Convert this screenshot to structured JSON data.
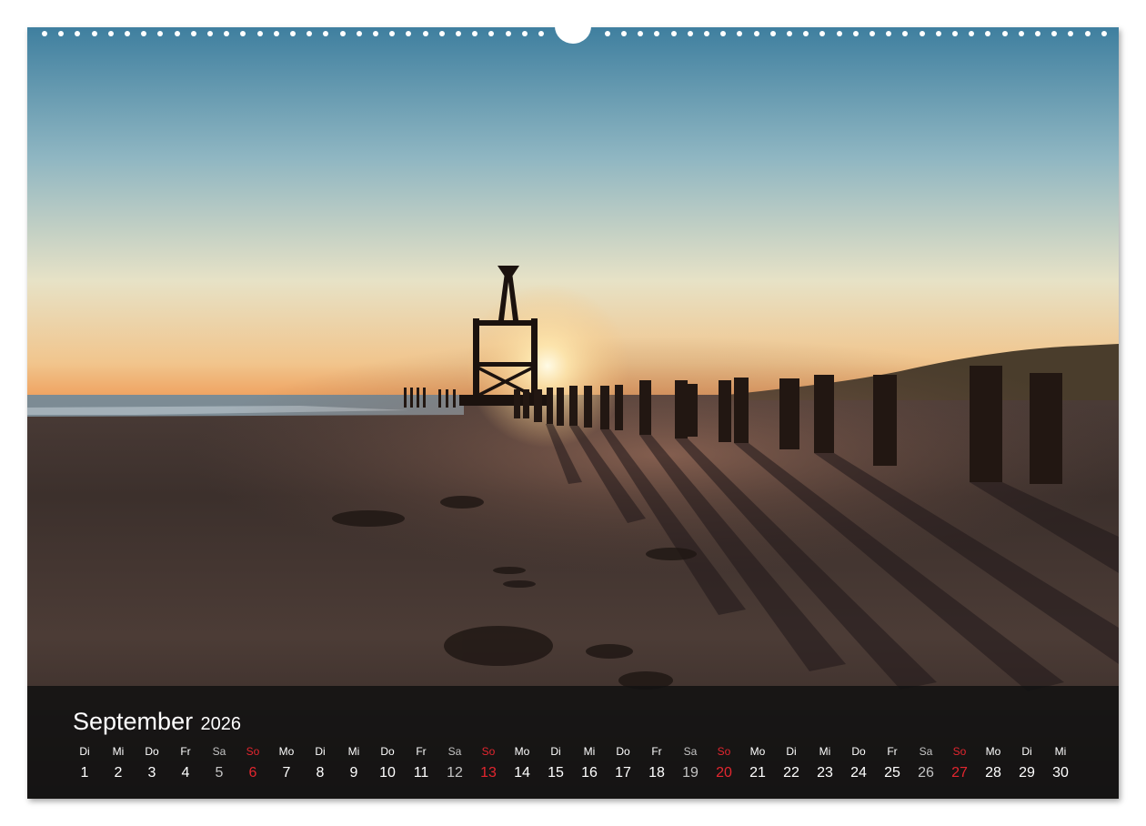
{
  "calendar": {
    "month": "September",
    "year": "2026",
    "days": [
      {
        "dow": "Di",
        "num": "1",
        "kind": "weekday"
      },
      {
        "dow": "Mi",
        "num": "2",
        "kind": "weekday"
      },
      {
        "dow": "Do",
        "num": "3",
        "kind": "weekday"
      },
      {
        "dow": "Fr",
        "num": "4",
        "kind": "weekday"
      },
      {
        "dow": "Sa",
        "num": "5",
        "kind": "saturday"
      },
      {
        "dow": "So",
        "num": "6",
        "kind": "sunday"
      },
      {
        "dow": "Mo",
        "num": "7",
        "kind": "weekday"
      },
      {
        "dow": "Di",
        "num": "8",
        "kind": "weekday"
      },
      {
        "dow": "Mi",
        "num": "9",
        "kind": "weekday"
      },
      {
        "dow": "Do",
        "num": "10",
        "kind": "weekday"
      },
      {
        "dow": "Fr",
        "num": "11",
        "kind": "weekday"
      },
      {
        "dow": "Sa",
        "num": "12",
        "kind": "saturday"
      },
      {
        "dow": "So",
        "num": "13",
        "kind": "sunday"
      },
      {
        "dow": "Mo",
        "num": "14",
        "kind": "weekday"
      },
      {
        "dow": "Di",
        "num": "15",
        "kind": "weekday"
      },
      {
        "dow": "Mi",
        "num": "16",
        "kind": "weekday"
      },
      {
        "dow": "Do",
        "num": "17",
        "kind": "weekday"
      },
      {
        "dow": "Fr",
        "num": "18",
        "kind": "weekday"
      },
      {
        "dow": "Sa",
        "num": "19",
        "kind": "saturday"
      },
      {
        "dow": "So",
        "num": "20",
        "kind": "sunday"
      },
      {
        "dow": "Mo",
        "num": "21",
        "kind": "weekday"
      },
      {
        "dow": "Di",
        "num": "22",
        "kind": "weekday"
      },
      {
        "dow": "Mi",
        "num": "23",
        "kind": "weekday"
      },
      {
        "dow": "Do",
        "num": "24",
        "kind": "weekday"
      },
      {
        "dow": "Fr",
        "num": "25",
        "kind": "weekday"
      },
      {
        "dow": "Sa",
        "num": "26",
        "kind": "saturday"
      },
      {
        "dow": "So",
        "num": "27",
        "kind": "sunday"
      },
      {
        "dow": "Mo",
        "num": "28",
        "kind": "weekday"
      },
      {
        "dow": "Di",
        "num": "29",
        "kind": "weekday"
      },
      {
        "dow": "Mi",
        "num": "30",
        "kind": "weekday"
      }
    ]
  },
  "colors": {
    "sunday": "#e3262f",
    "saturday": "#c4c4c4",
    "weekday": "#ffffff",
    "band": "#121111"
  }
}
